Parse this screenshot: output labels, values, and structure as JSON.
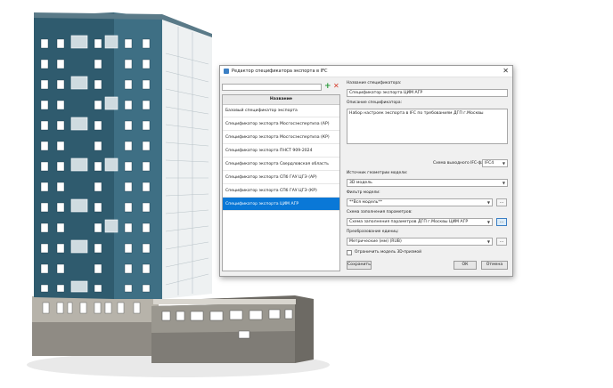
{
  "dialog": {
    "title": "Редактор спецификатора экспорта в IFC",
    "list": {
      "header": "Название",
      "items": [
        "Базовый спецификатор экспорта",
        "Спецификатор экспорта Мосгосэкспертиза (АР)",
        "Спецификатор экспорта Мосгосэкспертиза (КР)",
        "Спецификатор экспорта ПНСТ 909-2024",
        "Спецификатор экспорта Свердловская область",
        "Спецификатор экспорта СПб ГАУ ЦГЭ (АР)",
        "Спецификатор экспорта СПб ГАУ ЦГЭ (КР)",
        "Спецификатор экспорта ЦИМ АГР"
      ],
      "selected_index": 7
    },
    "name_label": "Название спецификатора:",
    "name_value": "Спецификатор экспорта ЦИМ АГР",
    "desc_label": "Описание спецификатора:",
    "desc_value": "Набор настроек экспорта в IFC по требованиям ДГП г.Москвы",
    "scheme_label": "Схема выходного IFC-файла:",
    "scheme_value": "IFC4",
    "geometry_label": "Источник геометрии модели:",
    "geometry_value": "3D модель",
    "filter_label": "Фильтр модели:",
    "filter_value": "**Вся модель**",
    "fill_label": "Схема заполнения параметров:",
    "fill_value": "Схема заполнения параметров ДГП г.Москвы ЦИМ АГР",
    "units_label": "Преобразование единиц:",
    "units_value": "Метрические (мм) (RUB)",
    "checkbox_label": "Ограничить модель 3D-призмой",
    "browse_label": "...",
    "save_label": "Сохранить",
    "ok_label": "ОК",
    "cancel_label": "Отмена"
  },
  "colors": {
    "selection": "#0a78d7",
    "facade_blue": "#2f5b6e",
    "facade_blue_light": "#4f8196",
    "podium": "#8a8780"
  }
}
